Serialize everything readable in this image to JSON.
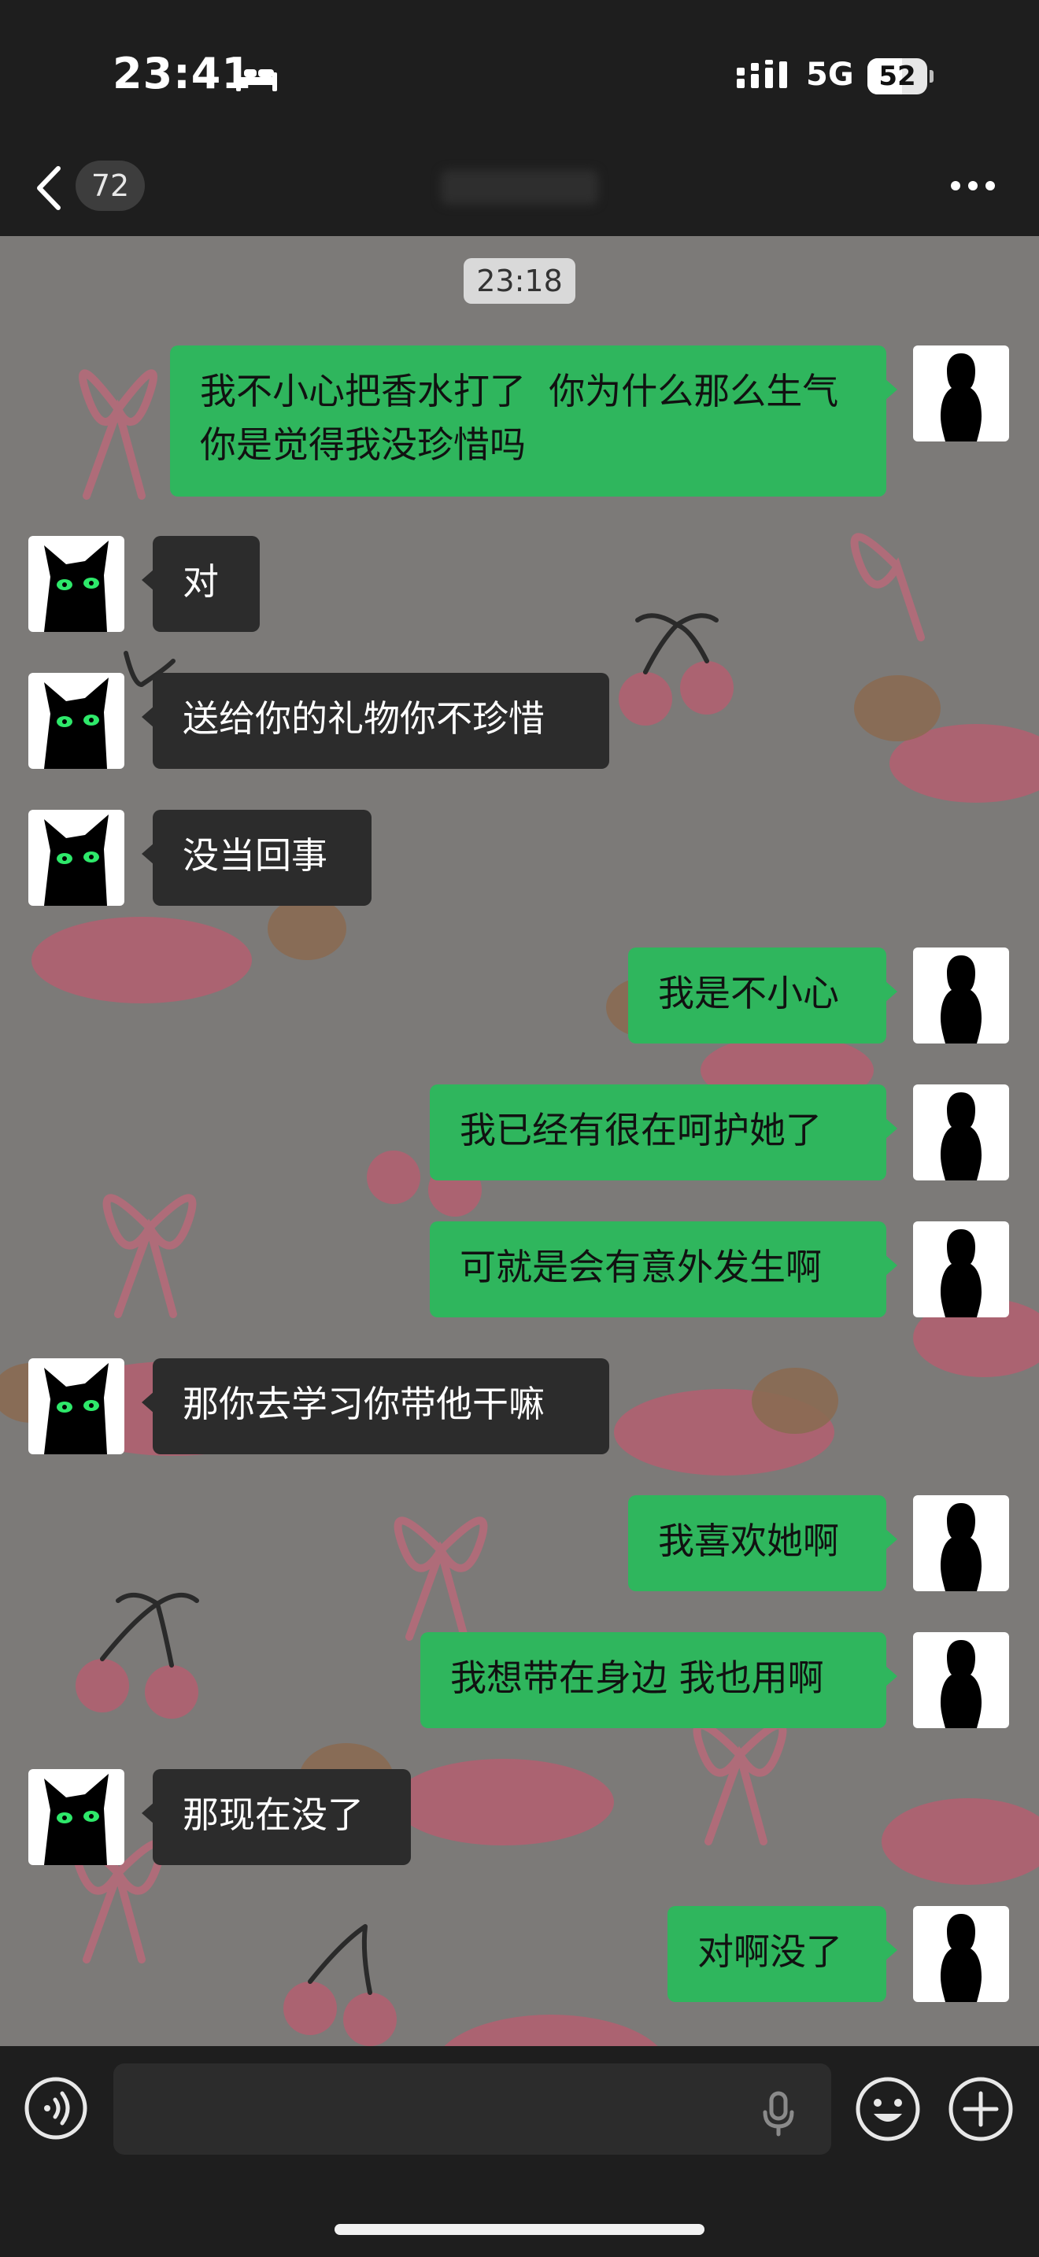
{
  "status_bar": {
    "time": "23:41",
    "network": "5G",
    "battery": "52",
    "battery_level": 0.52
  },
  "nav": {
    "unread_count": "72"
  },
  "chat": {
    "timestamp": "23:18",
    "messages": [
      {
        "from": "self",
        "text": "我不小心把香水打了  你为什么那么生气 你是觉得我没珍惜吗"
      },
      {
        "from": "other",
        "text": "对"
      },
      {
        "from": "other",
        "text": "送给你的礼物你不珍惜"
      },
      {
        "from": "other",
        "text": "没当回事"
      },
      {
        "from": "self",
        "text": "我是不小心"
      },
      {
        "from": "self",
        "text": "我已经有很在呵护她了"
      },
      {
        "from": "self",
        "text": "可就是会有意外发生啊"
      },
      {
        "from": "other",
        "text": "那你去学习你带他干嘛"
      },
      {
        "from": "self",
        "text": "我喜欢她啊"
      },
      {
        "from": "self",
        "text": "我想带在身边 我也用啊"
      },
      {
        "from": "other",
        "text": "那现在没了"
      },
      {
        "from": "self",
        "text": "对啊没了"
      }
    ]
  },
  "icons": {
    "back": "chevron-left-icon",
    "more": "more-dots-icon",
    "voice": "voice-icon",
    "mic": "mic-icon",
    "emoji": "emoji-icon",
    "plus": "plus-icon"
  },
  "colors": {
    "self_bubble": "#2fb65d",
    "other_bubble": "#2c2c2c",
    "bar_bg": "#1e1e1e",
    "wallpaper_bg": "#7c7a78"
  }
}
